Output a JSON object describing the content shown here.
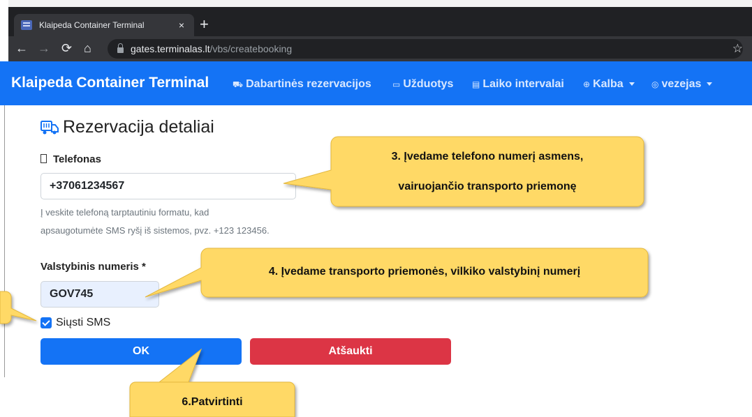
{
  "browser": {
    "tab_title": "Klaipeda Container Terminal",
    "tab_close": "×",
    "new_tab": "+",
    "url_host": "gates.terminalas.lt",
    "url_path": "/vbs/createbooking"
  },
  "navbar": {
    "brand": "Klaipeda Container Terminal",
    "items": [
      {
        "label": "Dabartinės rezervacijos",
        "icon": "truck-icon"
      },
      {
        "label": "Užduotys",
        "icon": "list-icon"
      },
      {
        "label": "Laiko intervalai",
        "icon": "calendar-icon"
      },
      {
        "label": "Kalba",
        "icon": "globe-icon",
        "dropdown": true
      },
      {
        "label": "vezejas",
        "icon": "user-icon",
        "dropdown": true
      }
    ]
  },
  "form": {
    "title": "Rezervacija detaliai",
    "phone_label": "Telefonas",
    "phone_value": "+37061234567",
    "phone_help": "Į veskite telefoną tarptautiniu formatu, kad apsaugotumėte SMS ryšį iš sistemos, pvz. +123 123456.",
    "plate_label": "Valstybinis numeris *",
    "plate_value": "GOV745",
    "sms_label": "Siųsti SMS",
    "sms_checked": true,
    "ok_label": "OK",
    "cancel_label": "Atšaukti"
  },
  "callouts": {
    "phone_line1": "3. Įvedame telefono numerį asmens,",
    "phone_line2": "vairuojančio transporto priemonę",
    "plate": "4. Įvedame transporto priemonės, vilkiko valstybinį numerį",
    "confirm": "6.Patvirtinti"
  },
  "colors": {
    "navbar": "#1473f5",
    "callout_fill": "#ffd966",
    "cancel": "#dc3545"
  }
}
